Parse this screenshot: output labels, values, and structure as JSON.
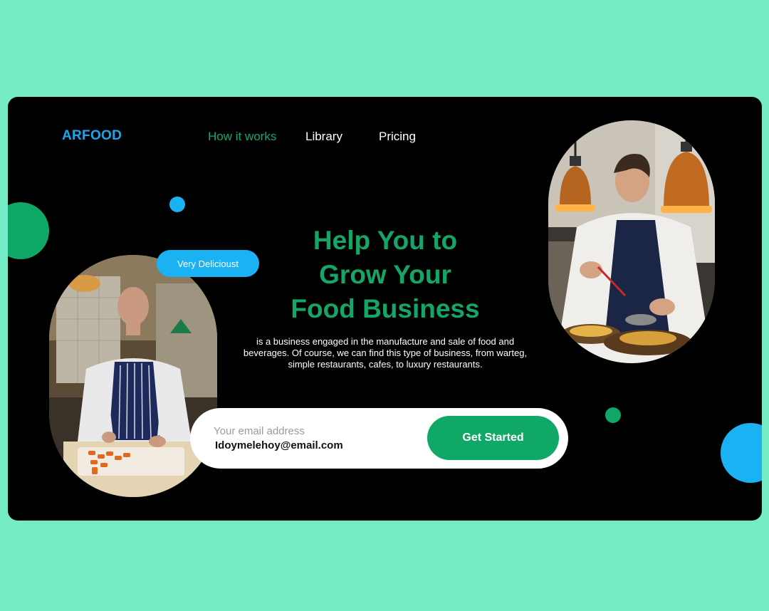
{
  "brand": {
    "logo": "ARFOOD"
  },
  "nav": {
    "how_it_works": "How it works",
    "library": "Library",
    "pricing": "Pricing"
  },
  "colors": {
    "background": "#75ebc6",
    "card": "#000000",
    "accent_green": "#0fa866",
    "accent_blue": "#1ab2f2"
  },
  "hero": {
    "line1": "Help You to",
    "line2": "Grow Your",
    "line3": "Food Business",
    "description": "is a business engaged in the manufacture and sale of food and beverages. Of course, we can find this type of business, from warteg, simple restaurants, cafes, to luxury restaurants."
  },
  "badge": {
    "label": "Very Delicioust"
  },
  "signup": {
    "label": "Your email address",
    "email": "Idoymelehoy@email.com",
    "button": "Get Started"
  },
  "images": {
    "left": "chef-cutting-carrots-photo",
    "right": "chef-plating-under-lamps-photo"
  }
}
